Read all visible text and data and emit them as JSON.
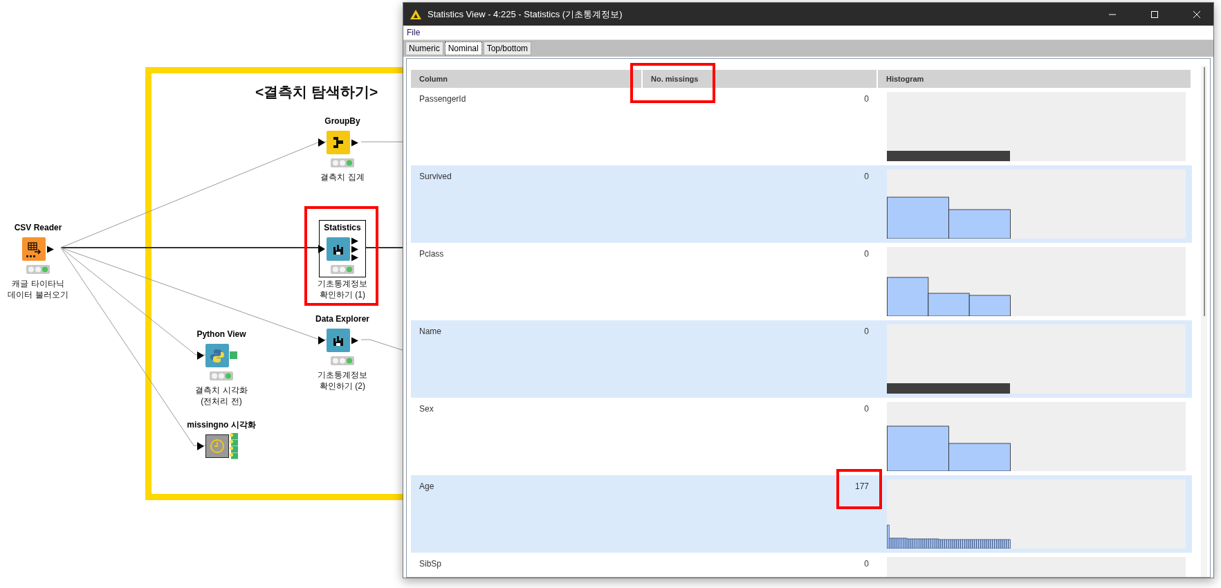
{
  "canvas": {
    "annotation": {
      "title": "<결측치 탐색하기>"
    },
    "nodes": [
      {
        "kind": "reader",
        "title": "CSV Reader",
        "label": "캐글 타이타닉\n데이터 불러오기",
        "selected": false
      },
      {
        "kind": "groupby",
        "title": "GroupBy",
        "label": "결측치 집계",
        "selected": false
      },
      {
        "kind": "statistics",
        "title": "Statistics",
        "label": "기초통계정보\n확인하기 (1)",
        "selected": true
      },
      {
        "kind": "explorer",
        "title": "Data Explorer",
        "label": "기초통계정보\n확인하기 (2)",
        "selected": false
      },
      {
        "kind": "python",
        "title": "Python View",
        "label": "결측치 시각화\n(전처리 전)",
        "selected": false
      },
      {
        "kind": "missingno",
        "title": "missingno 시각화",
        "selected": false
      }
    ]
  },
  "window": {
    "title": "Statistics View - 4:225 - Statistics (기초통계정보)",
    "menu": [
      "File"
    ],
    "tabs": [
      {
        "label": "Numeric",
        "selected": false
      },
      {
        "label": "Nominal",
        "selected": true
      },
      {
        "label": "Top/bottom",
        "selected": false
      }
    ],
    "table": {
      "columns": [
        "Column",
        "No. missings",
        "Histogram"
      ],
      "rows": [
        {
          "column": "PassengerId",
          "missings": "0"
        },
        {
          "column": "Survived",
          "missings": "0"
        },
        {
          "column": "Pclass",
          "missings": "0"
        },
        {
          "column": "Name",
          "missings": "0"
        },
        {
          "column": "Sex",
          "missings": "0"
        },
        {
          "column": "Age",
          "missings": "177"
        },
        {
          "column": "SibSp",
          "missings": "0"
        }
      ]
    }
  }
}
